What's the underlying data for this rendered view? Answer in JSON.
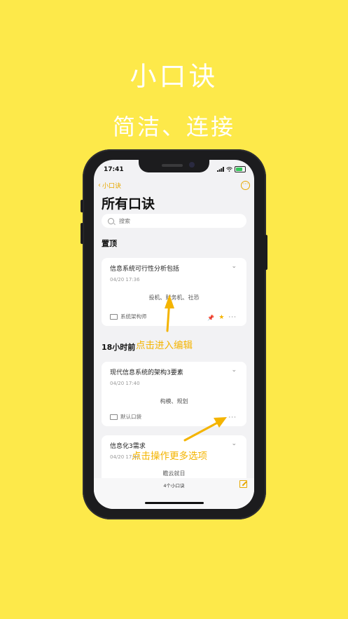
{
  "hero": {
    "title": "小口诀",
    "subtitle": "简洁、连接"
  },
  "status": {
    "time": "17:41"
  },
  "nav": {
    "back_label": "小口诀",
    "title": "所有口诀"
  },
  "search": {
    "placeholder": "搜索"
  },
  "sections": {
    "pinned": "置顶",
    "recent": "18小时前"
  },
  "cards": [
    {
      "title": "信息系统可行性分析包括",
      "date": "04/20 17:36",
      "body": "投机、财务机、社恐",
      "tag": "系统架构师",
      "pinned": true,
      "starred": true
    },
    {
      "title": "现代信息系统的架构3要素",
      "date": "04/20 17:40",
      "body": "构模、规划",
      "tag": "默认口袋"
    },
    {
      "title": "信息化3需求",
      "date": "04/20 17:40",
      "body": "瞻云就日"
    }
  ],
  "footer": {
    "count": "4个小口诀"
  },
  "annotations": {
    "edit_hint": "点击进入编辑",
    "more_hint": "点击操作更多选项"
  },
  "colors": {
    "background": "#fde94a",
    "accent": "#e7a800",
    "annotation": "#f4b400"
  }
}
